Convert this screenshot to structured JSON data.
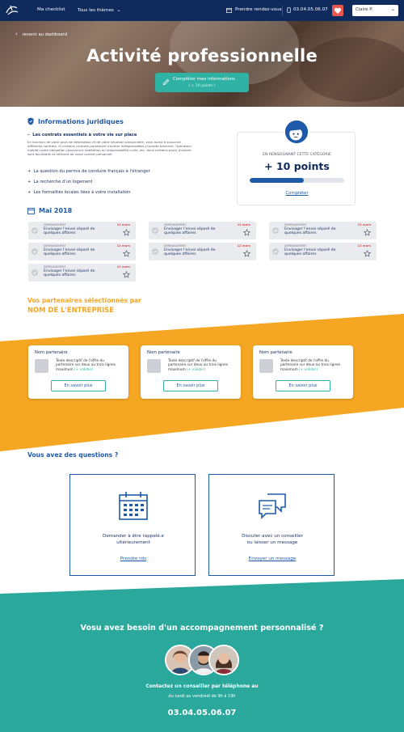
{
  "nav": {
    "checklist": "Ma checklist",
    "themes": "Tous les thèmes",
    "appointment": "Prendre rendez-vous",
    "phone": "03.04.05.06.07",
    "user": "Claire P."
  },
  "hero": {
    "back": "revenir au dashboard",
    "title": "Activité professionnelle",
    "cta_line1": "Compléter mes informations",
    "cta_line2": "( + 10 points )"
  },
  "legal": {
    "title": "Informations juridiques",
    "item1": "Les contrats essentiels à votre vie sur place",
    "item1_desc": "En fonction de votre pays de destination et de votre situation personnelle, vous aurez à souscrire différents contrats. Si certains contrats paraissent s'avérer indispensables (Compte bancaire, Opérateur mobile) votre obligation (Assurance habitation ou responsabilité civile, etc. dans certains pays) d'autres sont facultatifs et relèvent de votre confort personnel.",
    "item2": "La question du permis de conduire français à l'étranger",
    "item3": "La recherche d'un logement",
    "item4": "Les formalités locales liées à votre installation"
  },
  "points_card": {
    "label": "EN RENSEIGNANT CETTE CATÉGORIE",
    "value": "+ 10 points",
    "progress": 0.57,
    "link": "Compléter"
  },
  "month": "Mai 2018",
  "tasks": [
    {
      "category": "DEMENAGEMENT",
      "title": "Envisager l'envoi séparé de quelques affaires",
      "date": "12 mars"
    },
    {
      "category": "DEMENAGEMENT",
      "title": "Envisager l'envoi séparé de quelques affaires",
      "date": "12 mars"
    },
    {
      "category": "DEMENAGEMENT",
      "title": "Envisager l'envoi séparé de quelques affaires",
      "date": "12 mars"
    },
    {
      "category": "DEMENAGEMENT",
      "title": "Envisager l'envoi séparé de quelques affaires",
      "date": "12 mars"
    },
    {
      "category": "DEMENAGEMENT",
      "title": "Envisager l'envoi séparé de quelques affaires",
      "date": "12 mars"
    },
    {
      "category": "DEMENAGEMENT",
      "title": "Envisager l'envoi séparé de quelques affaires",
      "date": "12 mars"
    },
    {
      "category": "DEMENAGEMENT",
      "title": "Envisager l'envoi séparé de quelques affaires",
      "date": "12 mars"
    }
  ],
  "partners": {
    "title1": "Vos partenaires sélectionnés par",
    "title2": "NOM DE L'ENTREPRISE",
    "cards": [
      {
        "name": "Nom partenaire",
        "desc": "Texte descriptif de l'offre du partenaire sur deux ou trois lignes maximum",
        "more": "(+ valider)",
        "button": "En savoir plus"
      },
      {
        "name": "Nom partenaire",
        "desc": "Texte descriptif de l'offre du partenaire sur deux ou trois lignes maximum",
        "more": "(+ valider)",
        "button": "En savoir plus"
      },
      {
        "name": "Nom partenaire",
        "desc": "Texte descriptif de l'offre du partenaire sur deux ou trois lignes maximum",
        "more": "(+ valider)",
        "button": "En savoir plus"
      }
    ]
  },
  "questions": {
    "title": "Vous avez des questions ?",
    "box1_l1": "Demander à être rappelé.e",
    "box1_l2": "ultérieurement",
    "box1_link": "Prendre rdv",
    "box2_l1": "Discuter avec un conseiller",
    "box2_l2": "ou laisser un message",
    "box2_link": "Envoyer un message"
  },
  "bottom": {
    "title": "Vosu avez besoin d'un accompagnement personnalisé ?",
    "contact": "Contactez un conseiller par téléphone au",
    "hours": "du lundi au vendredi de 9h à 19h",
    "phone": "03.04.05.06.07"
  },
  "colors": {
    "navy": "#0f2a5c",
    "blue": "#1e5aa8",
    "teal": "#2aa89b",
    "orange": "#f5a623",
    "red": "#e05252"
  }
}
